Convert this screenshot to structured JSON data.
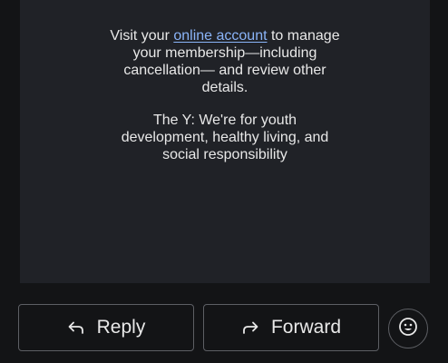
{
  "email": {
    "para1": {
      "prefix": "Visit your ",
      "link": "online account",
      "suffix": " to manage",
      "line2": "your membership—including",
      "line3": "cancellation— and review other",
      "line4": "details."
    },
    "para2": {
      "line1": "The Y: We're for youth",
      "line2": "development, healthy living, and",
      "line3": "social responsibility"
    }
  },
  "actions": {
    "reply_label": "Reply",
    "reply_icon": "reply-arrow-icon",
    "forward_label": "Forward",
    "forward_icon": "forward-arrow-icon",
    "emoji_icon": "smiley-face-icon"
  },
  "colors": {
    "background": "#131416",
    "card": "#202227",
    "link": "#8ab4f8",
    "border": "#5d5f64",
    "text": "#e8e8e8"
  }
}
